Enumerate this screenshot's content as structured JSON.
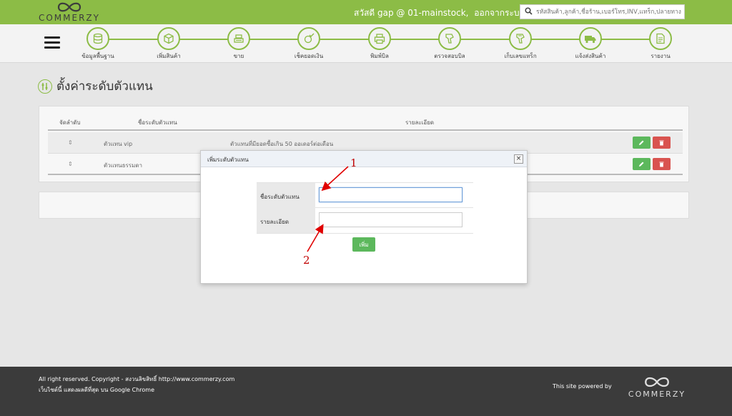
{
  "brand": {
    "logo_text": "COMMERZY"
  },
  "header": {
    "greeting": "สวัสดี gap @ 01-mainstock,",
    "logout": "ออกจากระบบ",
    "search_placeholder": "รหัสสินค้า,ลูกค้า,ชื่อร้าน,เบอร์โทร,INV,แทร็ก,ปลายทาง"
  },
  "nav": {
    "items": [
      {
        "label": "ข้อมูลพื้นฐาน",
        "icon": "database-icon"
      },
      {
        "label": "เพิ่มสินค้า",
        "icon": "box-icon"
      },
      {
        "label": "ขาย",
        "icon": "cash-register-icon"
      },
      {
        "label": "เช็คยอดเงิน",
        "icon": "check-money-icon"
      },
      {
        "label": "พิมพ์บิล",
        "icon": "printer-icon"
      },
      {
        "label": "ตรวจสอบบิล",
        "icon": "scanner-icon"
      },
      {
        "label": "เก็บเลขแทร็ก",
        "icon": "barcode-scanner-icon"
      },
      {
        "label": "แจ้งส่งสินค้า",
        "icon": "truck-icon"
      },
      {
        "label": "รายงาน",
        "icon": "report-icon"
      }
    ],
    "accent": "#8cbc46"
  },
  "page": {
    "title": "ตั้งค่าระดับตัวแทน"
  },
  "table": {
    "headers": {
      "order": "จัดลำดับ",
      "name": "ชื่อระดับตัวแทน",
      "detail": "รายละเอียด"
    },
    "rows": [
      {
        "name": "ตัวแทน vip",
        "detail": "ตัวแทนที่มียอดซื้อเกิน 50 ออเดอร์ต่อเดือน"
      },
      {
        "name": "ตัวแทนธรรมดา",
        "detail": ""
      }
    ]
  },
  "modal": {
    "title": "เพิ่มระดับตัวแทน",
    "close_label": "×",
    "fields": {
      "name_label": "ชื่อระดับตัวแทน",
      "name_value": "",
      "detail_label": "รายละเอียด",
      "detail_value": ""
    },
    "add_label": "เพิ่ม"
  },
  "annotations": {
    "one": "1",
    "two": "2",
    "color": "#c00000"
  },
  "footer": {
    "line1": "All right reserved. Copyright - สงวนลิขสิทธิ์ http://www.commerzy.com",
    "line2": "เว็บไซต์นี้ แสดงผลดีที่สุด บน Google Chrome",
    "powered": "This site powered by",
    "logo_text": "COMMERZY"
  }
}
